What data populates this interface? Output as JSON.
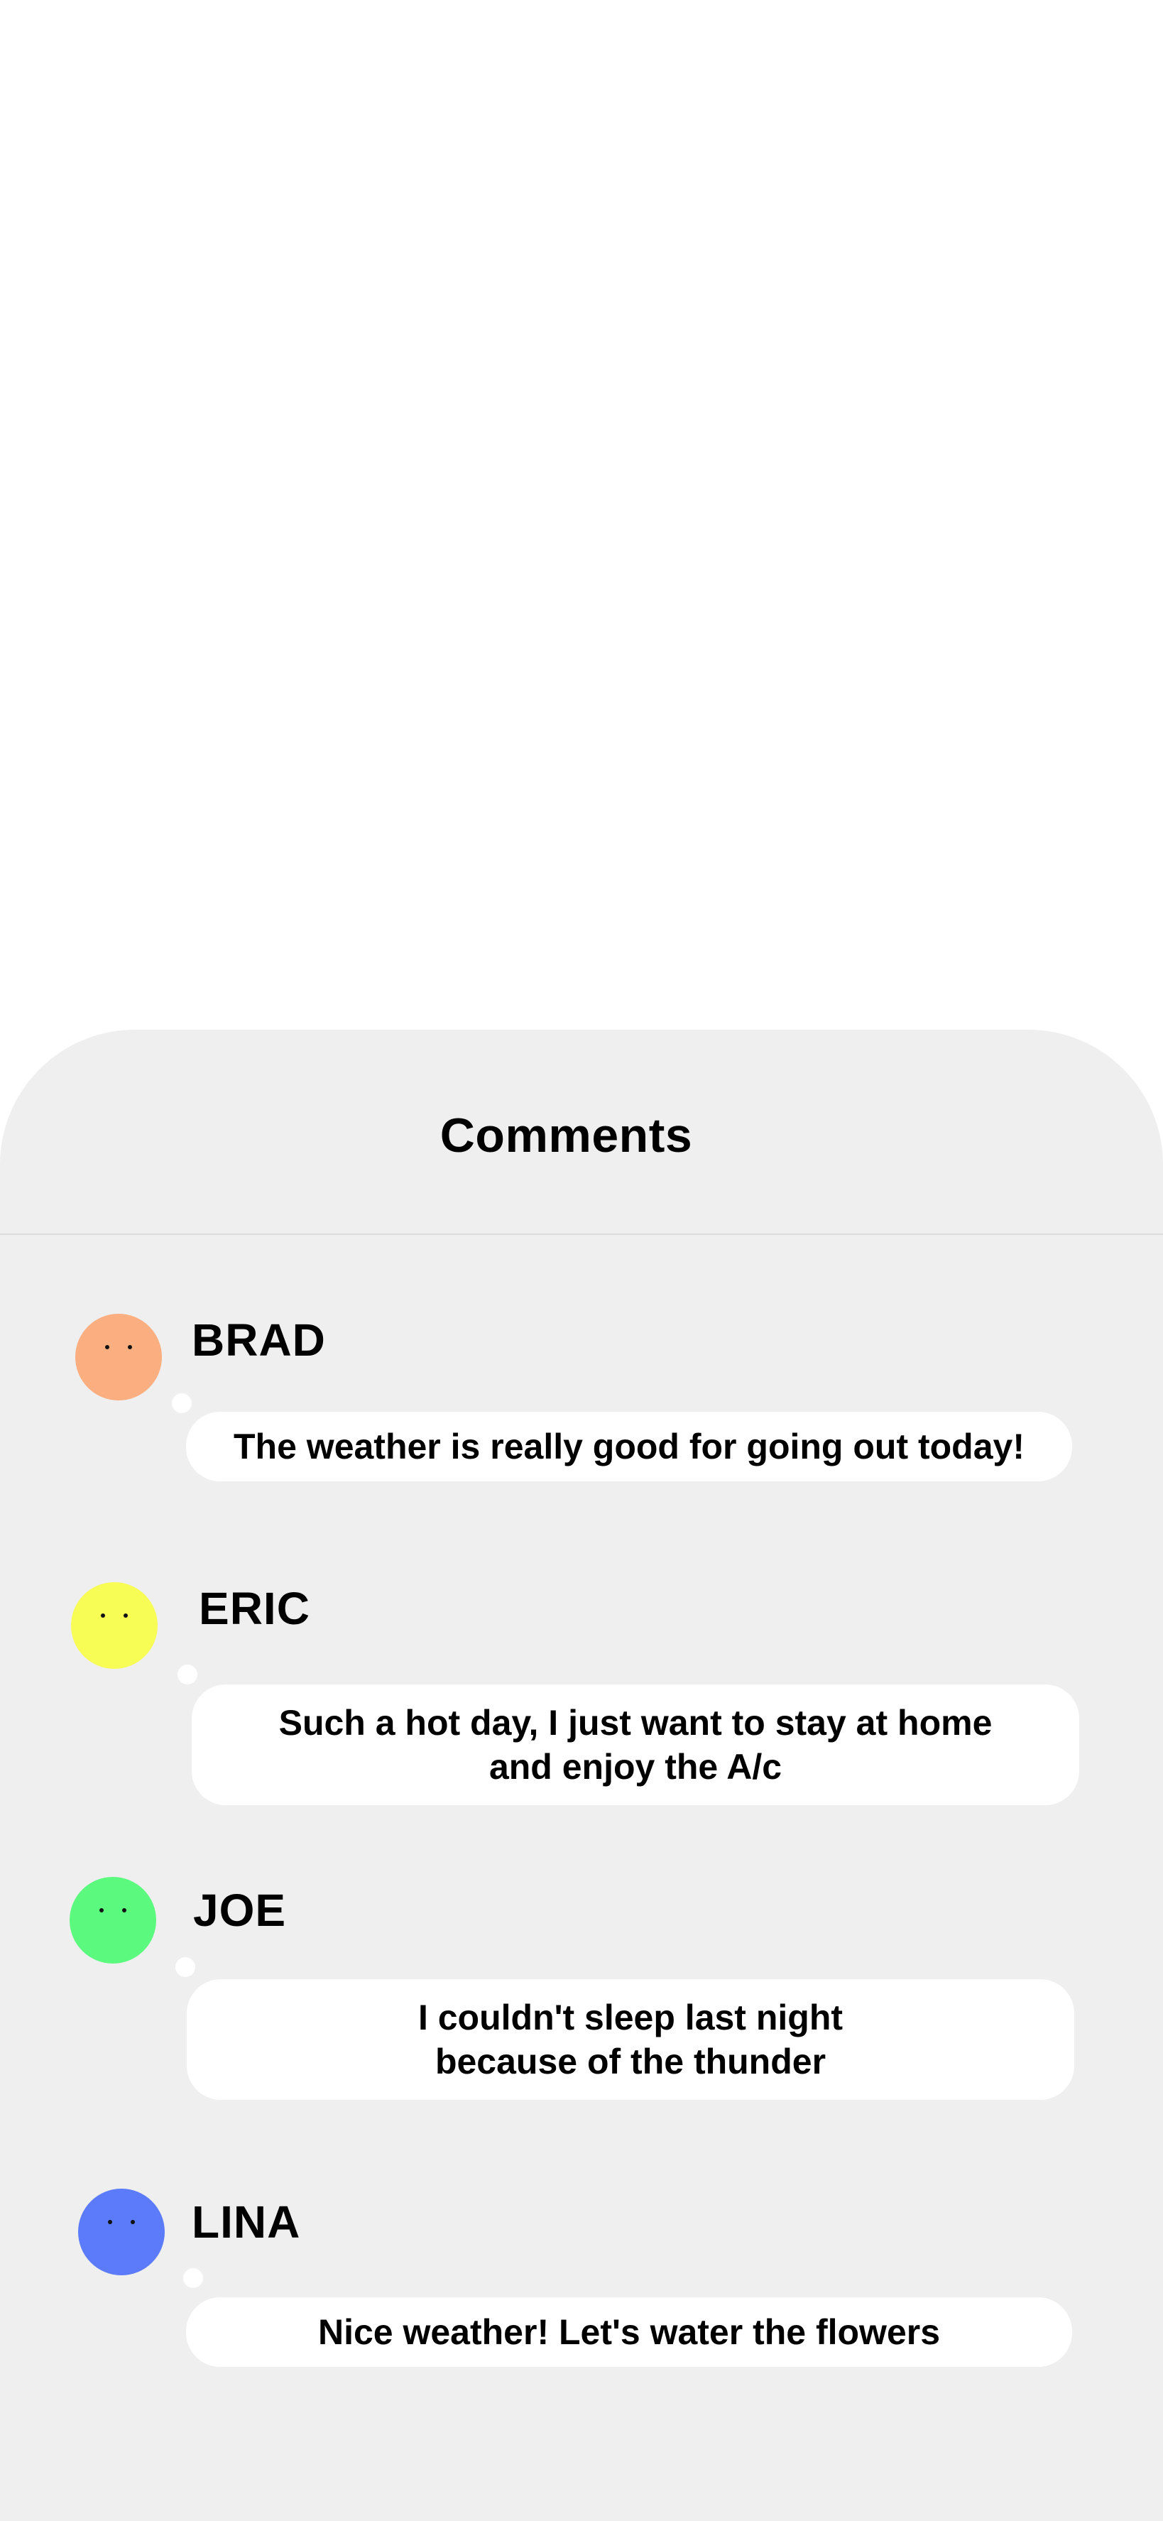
{
  "sheet": {
    "title": "Comments"
  },
  "comments": [
    {
      "name": "BRAD",
      "text": "The weather is really good for going out today!",
      "avatar_color": "#FBAE7F"
    },
    {
      "name": "ERIC",
      "text": "Such a hot day, I just want to stay at home and enjoy the A/c",
      "avatar_color": "#F7FD55"
    },
    {
      "name": "JOE",
      "text": "I couldn't sleep last night because of the thunder",
      "avatar_color": "#5BFA7F"
    },
    {
      "name": "LINA",
      "text": "Nice weather! Let's water the flowers",
      "avatar_color": "#5B7BFA"
    }
  ],
  "colors": {
    "sheet_background": "#EFEFEF",
    "bubble_background": "#FFFFFF"
  }
}
